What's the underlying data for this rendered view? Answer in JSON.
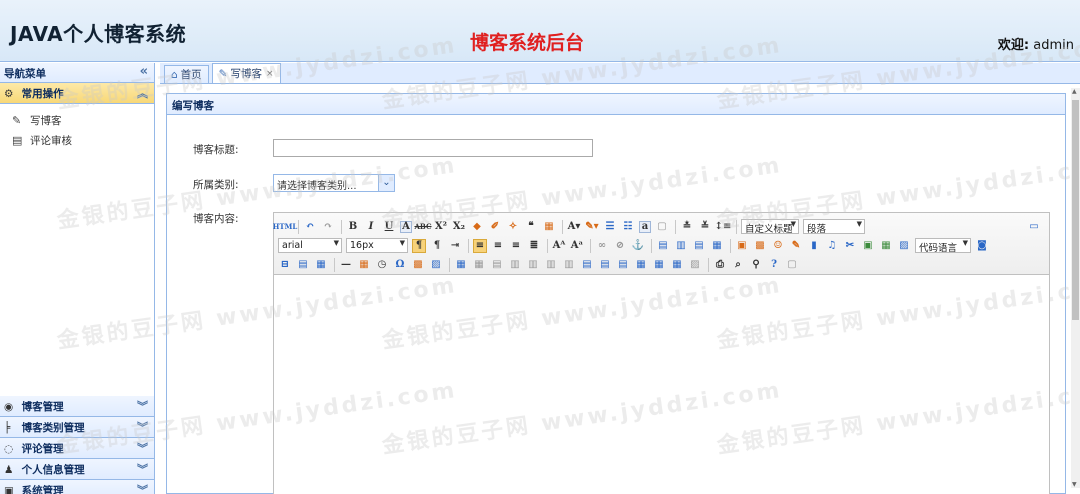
{
  "header": {
    "logo": "JAVA个人博客系统",
    "center_title": "博客系统后台",
    "welcome_label": "欢迎:",
    "user": "admin"
  },
  "sidebar": {
    "nav_title": "导航菜单",
    "collapse_glyph": "«",
    "active_group": "常用操作",
    "active_items": [
      {
        "label": "写博客",
        "icon": "edit-icon"
      },
      {
        "label": "评论审核",
        "icon": "comment-review-icon"
      }
    ],
    "groups": [
      {
        "label": "博客管理",
        "icon": "blog-icon"
      },
      {
        "label": "博客类别管理",
        "icon": "category-icon"
      },
      {
        "label": "评论管理",
        "icon": "comment-icon"
      },
      {
        "label": "个人信息管理",
        "icon": "user-icon"
      },
      {
        "label": "系统管理",
        "icon": "system-icon"
      }
    ]
  },
  "tabs": [
    {
      "label": "首页",
      "icon": "home-icon"
    },
    {
      "label": "写博客",
      "icon": "edit-icon",
      "close": "×"
    }
  ],
  "panel": {
    "title": "编写博客",
    "title_label": "博客标题:",
    "title_value": "",
    "category_label": "所属类别:",
    "category_value": "请选择博客类别...",
    "content_label": "博客内容:"
  },
  "editor": {
    "font_family": "arial",
    "font_size": "16px",
    "custom_heading": "自定义标题",
    "paragraph": "段落",
    "code_language": "代码语言"
  },
  "watermark": "金银的豆子网 www.jyddzi.com"
}
